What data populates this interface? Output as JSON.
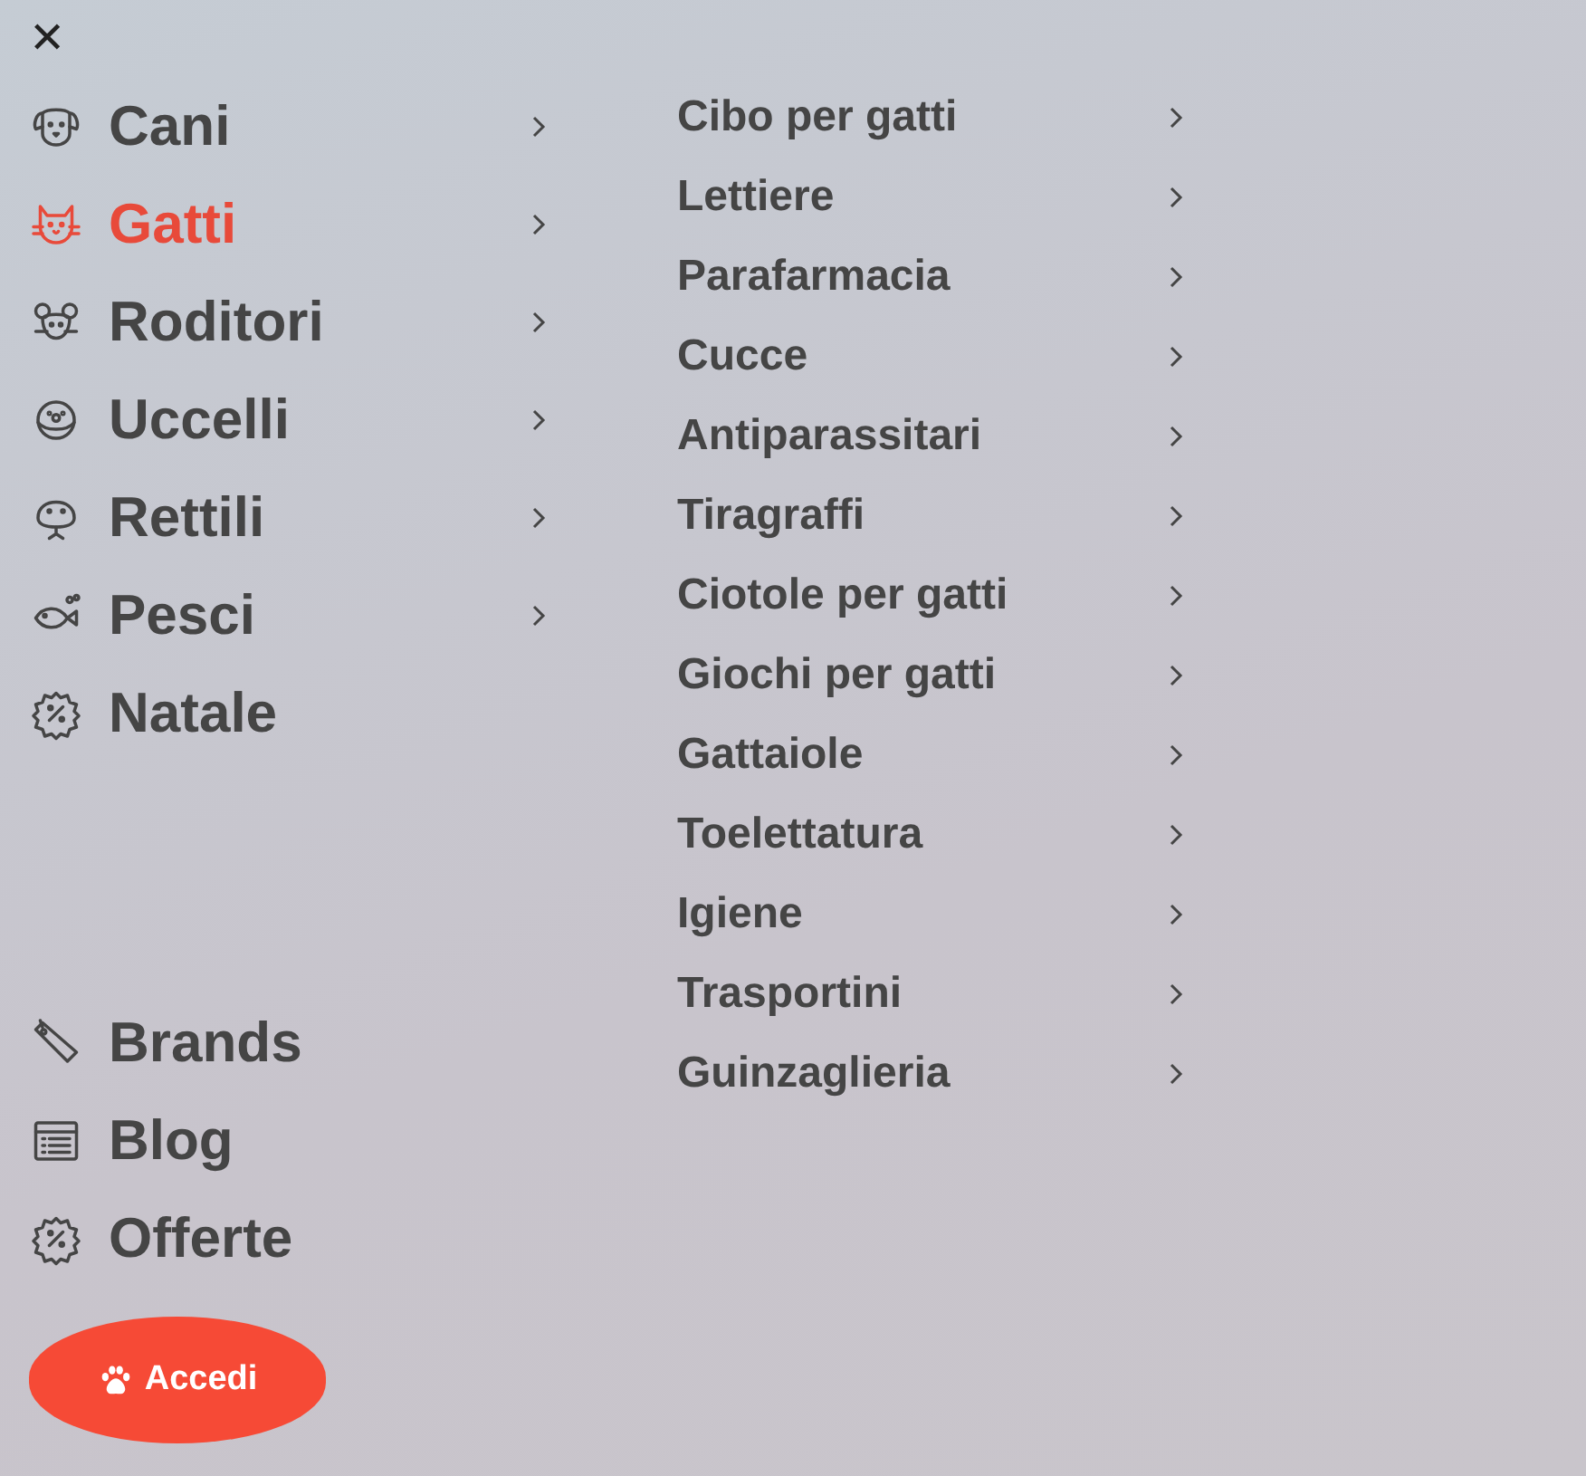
{
  "close_button": {
    "label": "✕"
  },
  "categories": [
    {
      "label": "Cani",
      "selected": false,
      "expandable": true
    },
    {
      "label": "Gatti",
      "selected": true,
      "expandable": true
    },
    {
      "label": "Roditori",
      "selected": false,
      "expandable": true
    },
    {
      "label": "Uccelli",
      "selected": false,
      "expandable": true
    },
    {
      "label": "Rettili",
      "selected": false,
      "expandable": true
    },
    {
      "label": "Pesci",
      "selected": false,
      "expandable": true
    },
    {
      "label": "Natale",
      "selected": false,
      "expandable": false
    }
  ],
  "links": [
    {
      "label": "Brands"
    },
    {
      "label": "Blog"
    },
    {
      "label": "Offerte"
    }
  ],
  "login_button": {
    "label": "Accedi"
  },
  "submenu": [
    {
      "label": "Cibo per gatti",
      "expandable": true
    },
    {
      "label": "Lettiere",
      "expandable": true
    },
    {
      "label": "Parafarmacia",
      "expandable": true
    },
    {
      "label": "Cucce",
      "expandable": true
    },
    {
      "label": "Antiparassitari",
      "expandable": true
    },
    {
      "label": "Tiragraffi",
      "expandable": true
    },
    {
      "label": "Ciotole per gatti",
      "expandable": true
    },
    {
      "label": "Giochi per gatti",
      "expandable": true
    },
    {
      "label": "Gattaiole",
      "expandable": true
    },
    {
      "label": "Toelettatura",
      "expandable": true
    },
    {
      "label": "Igiene",
      "expandable": true
    },
    {
      "label": "Trasportini",
      "expandable": true
    },
    {
      "label": "Guinzaglieria",
      "expandable": true
    }
  ]
}
